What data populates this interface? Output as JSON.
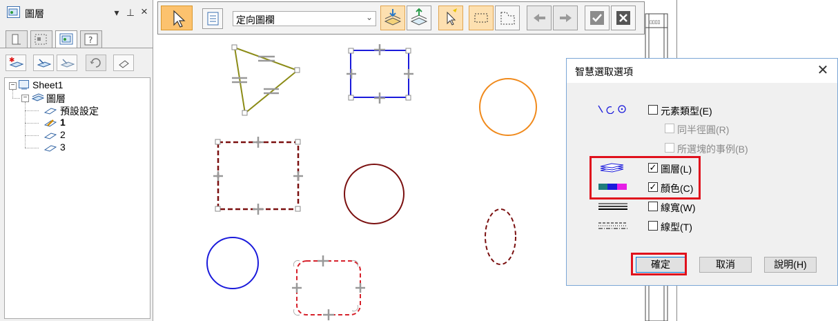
{
  "panel": {
    "title": "圖層",
    "tree": {
      "root": "Sheet1",
      "group": "圖層",
      "items": [
        "預設設定",
        "1",
        "2",
        "3"
      ]
    }
  },
  "toolbar": {
    "layer_select_value": "定向圖欄"
  },
  "dialog": {
    "title": "智慧選取選項",
    "options": {
      "element_type": {
        "label": "元素類型(E)",
        "checked": false
      },
      "same_radius": {
        "label": "同半徑圓(R)",
        "checked": false
      },
      "block_instances": {
        "label": "所選塊的事例(B)",
        "checked": false
      },
      "layer": {
        "label": "圖層(L)",
        "checked": true
      },
      "color": {
        "label": "顏色(C)",
        "checked": true
      },
      "line_width": {
        "label": "線寬(W)",
        "checked": false
      },
      "line_type": {
        "label": "線型(T)",
        "checked": false
      }
    },
    "buttons": {
      "ok": "確定",
      "cancel": "取消",
      "help": "說明(H)"
    }
  },
  "colors": {
    "accent": "#0078d7",
    "highlight_red": "#e0101c",
    "olive": "#8b8b16",
    "blue": "#1a1adb",
    "orange": "#f08a1c",
    "dark_red": "#7a0f0f",
    "red_dash": "#d6202a"
  }
}
